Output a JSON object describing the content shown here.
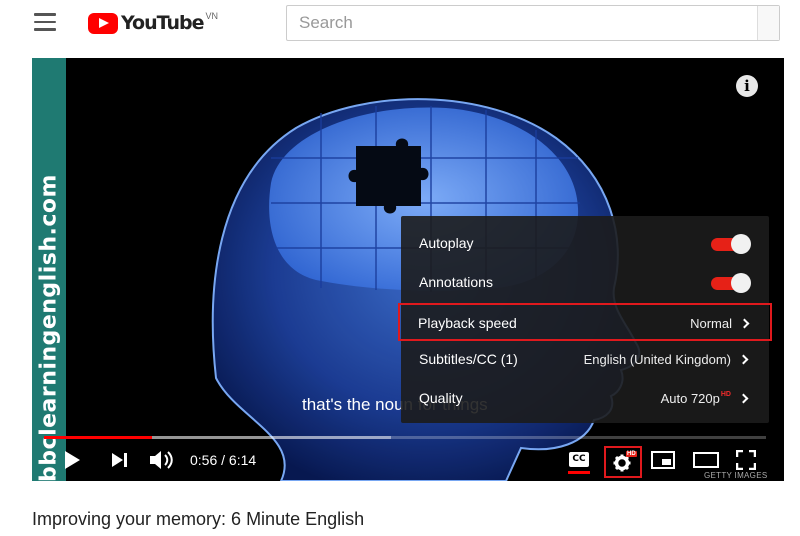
{
  "header": {
    "logo_text": "YouTube",
    "logo_region": "VN",
    "search_placeholder": "Search"
  },
  "player": {
    "side_banner_text": "bbclearningenglish.com",
    "subtitle_text": "that's the noun for things",
    "watermark": "GETTY IMAGES",
    "time_display": "0:56 / 6:14",
    "progress_played": 0.15,
    "progress_buffered": 0.48,
    "cc_label": "CC",
    "gear_badge": "HD",
    "settings_menu": [
      {
        "label": "Autoplay",
        "type": "toggle",
        "on": true
      },
      {
        "label": "Annotations",
        "type": "toggle",
        "on": true
      },
      {
        "label": "Playback speed",
        "type": "submenu",
        "value": "Normal",
        "highlighted": true
      },
      {
        "label": "Subtitles/CC (1)",
        "type": "submenu",
        "value": "English (United Kingdom)"
      },
      {
        "label": "Quality",
        "type": "submenu",
        "value": "Auto 720p",
        "value_badge": "HD"
      }
    ]
  },
  "video": {
    "title": "Improving your memory: 6 Minute English"
  },
  "colors": {
    "brand_red": "#ff0000",
    "toggle_red": "#e62117",
    "highlight_red": "#e0191d",
    "banner_teal": "#1f7a72"
  },
  "icons": {
    "menu": "hamburger-icon",
    "info": "info-icon",
    "play": "play-icon",
    "next": "next-icon",
    "volume": "volume-icon",
    "settings": "gear-icon",
    "miniplayer": "miniplayer-icon",
    "theater": "theater-icon",
    "fullscreen": "fullscreen-icon"
  }
}
